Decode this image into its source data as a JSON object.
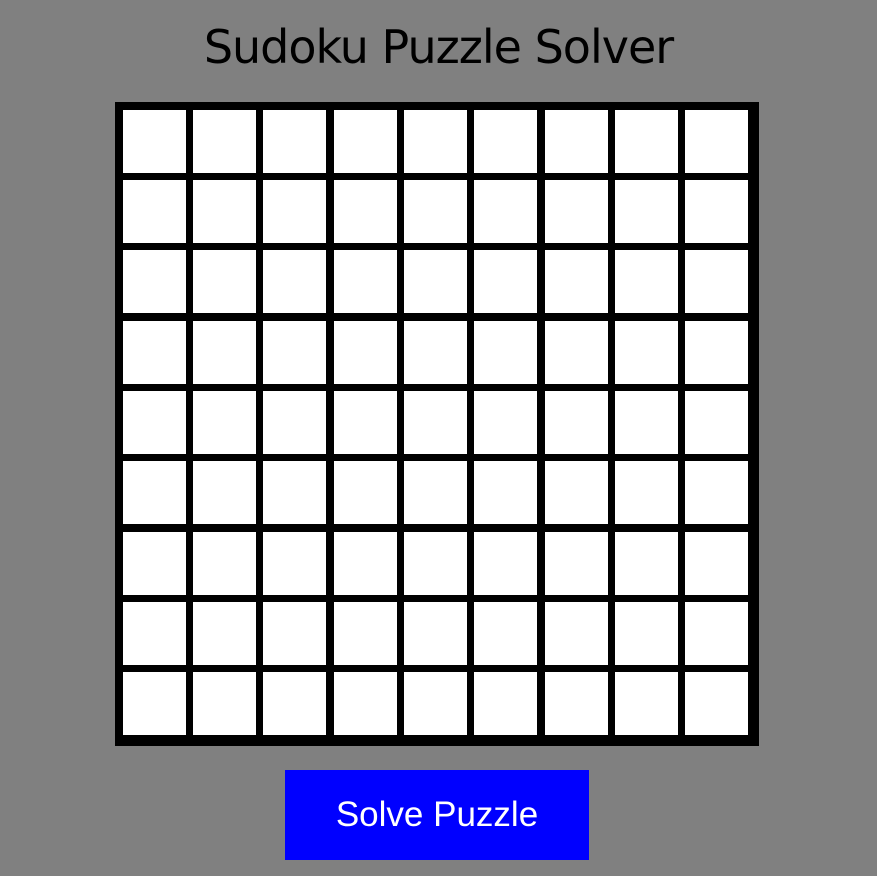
{
  "page": {
    "title": "Sudoku Puzzle Solver",
    "background_color": "#808080"
  },
  "board": {
    "rows": 9,
    "cols": 9,
    "cells": [
      [
        "",
        "",
        "",
        "",
        "",
        "",
        "",
        "",
        ""
      ],
      [
        "",
        "",
        "",
        "",
        "",
        "",
        "",
        "",
        ""
      ],
      [
        "",
        "",
        "",
        "",
        "",
        "",
        "",
        "",
        ""
      ],
      [
        "",
        "",
        "",
        "",
        "",
        "",
        "",
        "",
        ""
      ],
      [
        "",
        "",
        "",
        "",
        "",
        "",
        "",
        "",
        ""
      ],
      [
        "",
        "",
        "",
        "",
        "",
        "",
        "",
        "",
        ""
      ],
      [
        "",
        "",
        "",
        "",
        "",
        "",
        "",
        "",
        ""
      ],
      [
        "",
        "",
        "",
        "",
        "",
        "",
        "",
        "",
        ""
      ],
      [
        "",
        "",
        "",
        "",
        "",
        "",
        "",
        "",
        ""
      ]
    ]
  },
  "actions": {
    "solve_label": "Solve Puzzle",
    "solve_color": "#0000ff"
  }
}
